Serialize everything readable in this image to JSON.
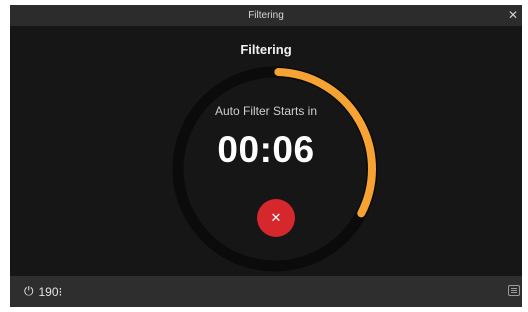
{
  "window": {
    "title": "Filtering",
    "close_icon": "close-icon"
  },
  "main": {
    "heading": "Filtering",
    "status_label": "Auto Filter Starts in",
    "timer": "00:06",
    "progress_fraction": 0.32,
    "cancel_icon": "close-icon",
    "cancel_symbol": "✕"
  },
  "footer": {
    "power_icon": "power-icon",
    "power_symbol": "⏻",
    "power_value": "190⁝",
    "keyboard_icon": "keyboard-icon"
  },
  "colors": {
    "progress": "#f6a333",
    "track": "#0b0b0b",
    "cancel": "#d6282c",
    "background": "#161616",
    "titlebar": "#2c2c2c"
  }
}
